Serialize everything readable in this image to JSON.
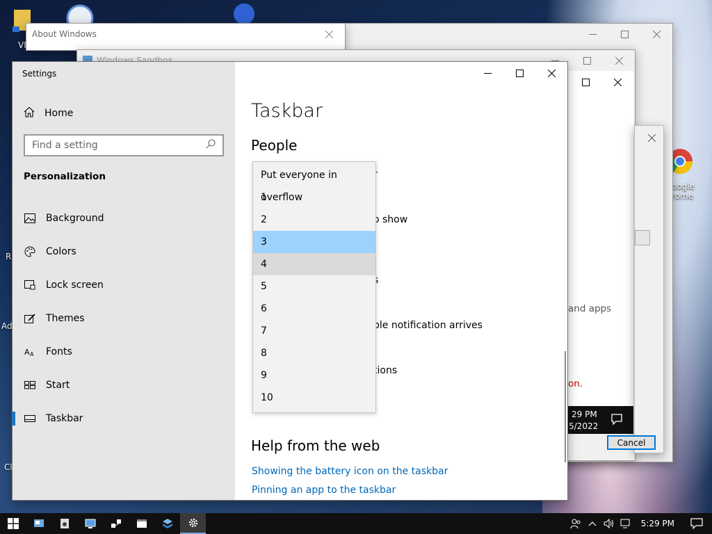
{
  "desktop": {
    "labels": {
      "vm": "VM",
      "r": "R",
      "ad": "Ad",
      "cl": "Cl",
      "chrome_1": "oogle",
      "chrome_2": "rome"
    }
  },
  "about_windows": {
    "title": "About Windows"
  },
  "sandbox": {
    "title": "Windows Sandbox"
  },
  "background_dialog": {
    "and_apps": "and apps",
    "red_text": "on.",
    "time": "29 PM",
    "date": "5/2022",
    "cancel_label": "Cancel"
  },
  "settings": {
    "window_title": "Settings",
    "home_label": "Home",
    "search_placeholder": "Find a setting",
    "group_label": "Personalization",
    "nav_items": [
      {
        "label": "Background",
        "icon": "image-icon"
      },
      {
        "label": "Colors",
        "icon": "palette-icon"
      },
      {
        "label": "Lock screen",
        "icon": "lock-screen-icon"
      },
      {
        "label": "Themes",
        "icon": "brush-icon"
      },
      {
        "label": "Fonts",
        "icon": "fonts-icon"
      },
      {
        "label": "Start",
        "icon": "start-icon"
      },
      {
        "label": "Taskbar",
        "icon": "taskbar-icon"
      }
    ],
    "selected_nav": "Taskbar",
    "page_title": "Taskbar",
    "section_people": "People",
    "partial_texts": {
      "t1": "r",
      "t2": "o show",
      "t3": "s",
      "t4": "ple notification arrives",
      "t5": "tions"
    },
    "dropdown": {
      "options": [
        "Put everyone in overflow",
        "1",
        "2",
        "3",
        "4",
        "5",
        "6",
        "7",
        "8",
        "9",
        "10"
      ],
      "selected": "3",
      "hovered": "4"
    },
    "help_title": "Help from the web",
    "help_links": [
      "Showing the battery icon on the taskbar",
      "Pinning an app to the taskbar"
    ]
  },
  "taskbar": {
    "clock_time": "5:29 PM",
    "accent": "#0078d7"
  }
}
